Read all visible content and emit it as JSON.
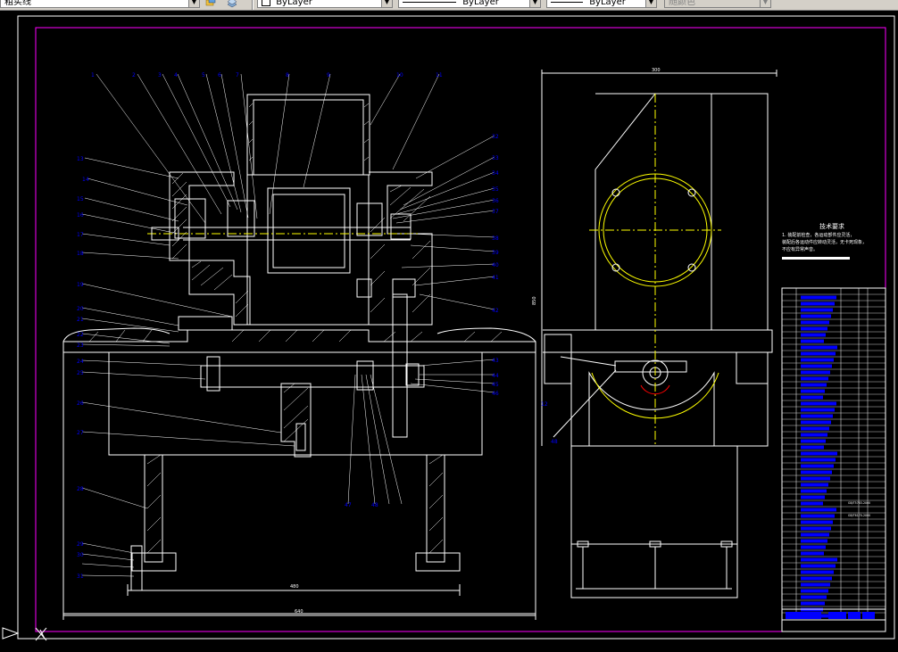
{
  "toolbar": {
    "linetype_combo": "粗实线",
    "color_combo": "ByLayer",
    "linetype2_combo": "ByLayer",
    "lineweight_combo": "ByLayer",
    "plotstyle_combo": "随颜色"
  },
  "drawing": {
    "tech_requirements_title": "技术要求",
    "tech_requirements_line1": "1. 装配前检查，各运动部件应灵活，",
    "tech_requirements_line2": "装配后各运动件应转动灵活，无卡死现象，",
    "tech_requirements_line3": "不应有异常声音。",
    "dim_total_width": "640",
    "dim_base_width": "480",
    "dim_top_width": "300",
    "dim_height": "850",
    "balloons_top": [
      "1",
      "2",
      "3",
      "4",
      "5",
      "6",
      "7",
      "8",
      "9",
      "10",
      "11",
      "12"
    ],
    "balloons_left": [
      "13",
      "14",
      "15",
      "16",
      "17",
      "18",
      "19",
      "20",
      "21",
      "22",
      "23",
      "24",
      "25",
      "26",
      "27",
      "28",
      "29",
      "30",
      "31"
    ],
    "balloons_right": [
      "32",
      "33",
      "34",
      "35",
      "36",
      "37",
      "38",
      "39",
      "40",
      "41",
      "42",
      "43",
      "44",
      "45",
      "46",
      "47",
      "48"
    ],
    "bom_part1": "GB/T5783-2000",
    "bom_part2": "GB/T6170-2000"
  },
  "colors": {
    "background": "#000000",
    "frame": "#ff00ff",
    "lines": "#ffffff",
    "centerline": "#ffff00",
    "balloon_text": "#0000ff",
    "hidden": "#ff0000"
  }
}
